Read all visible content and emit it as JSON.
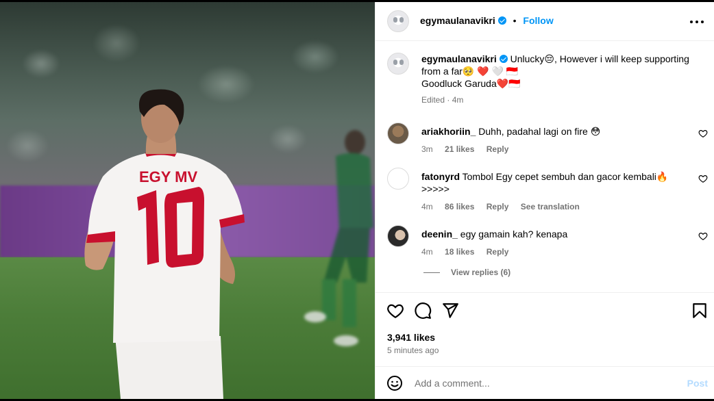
{
  "header": {
    "username": "egymaulanavikri",
    "separator": "•",
    "follow_label": "Follow"
  },
  "caption": {
    "username": "egymaulanavikri",
    "line1": "Unlucky😔, However i will keep supporting",
    "line2": "from a far🥺 ❤️ 🤍 🇮🇩",
    "line3": "Goodluck Garuda❤️🇮🇩",
    "meta": "Edited · 4m"
  },
  "comments": [
    {
      "username": "ariakhoriin_",
      "text": "Duhh, padahal lagi on fire 😳",
      "time": "3m",
      "likes": "21 likes",
      "reply": "Reply"
    },
    {
      "username": "fatonyrd",
      "text": "Tombol Egy cepet sembuh dan gacor kembali🔥",
      "text2": ">>>>>",
      "time": "4m",
      "likes": "86 likes",
      "reply": "Reply",
      "translate": "See translation"
    },
    {
      "username": "deenin_",
      "text": "egy gamain kah? kenapa",
      "time": "4m",
      "likes": "18 likes",
      "reply": "Reply"
    }
  ],
  "view_replies": "View replies (6)",
  "likes_count": "3,941 likes",
  "time_ago": "5 minutes ago",
  "composer": {
    "placeholder": "Add a comment...",
    "post_label": "Post"
  },
  "photo": {
    "jersey_name": "EGY MV",
    "jersey_number": "10"
  },
  "colors": {
    "accent": "#0095f6",
    "secondary_text": "#737373",
    "jersey_red": "#c8102e"
  }
}
